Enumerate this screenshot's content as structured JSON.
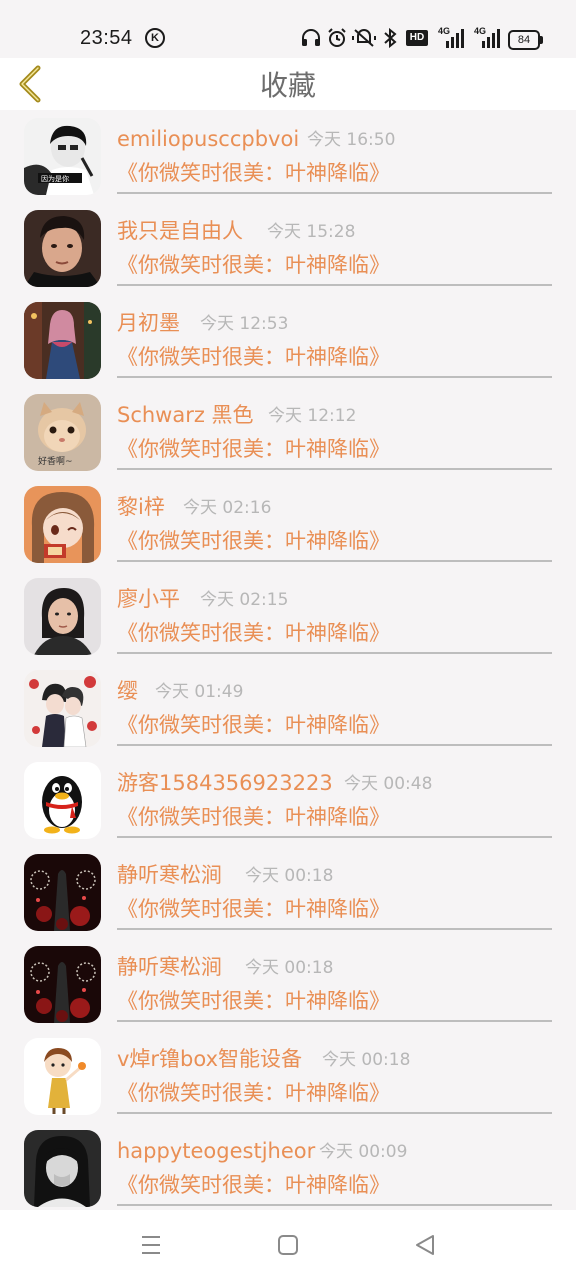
{
  "status_bar": {
    "time": "23:54",
    "k_badge": "K",
    "hd_label": "HD",
    "net1": "4G",
    "net2": "4G",
    "battery": "84"
  },
  "header": {
    "title": "收藏",
    "back_icon": "chevron-left-icon",
    "accent": "#a48a1c"
  },
  "items": [
    {
      "name": "emiliopusccpbvoi",
      "time": "今天 16:50",
      "book": "《你微笑时很美：叶神降临》",
      "avatar": "avatar-bw-man"
    },
    {
      "name": "我只是自由人",
      "time": "今天 15:28",
      "book": "《你微笑时很美：叶神降临》",
      "avatar": "avatar-man-dark"
    },
    {
      "name": "月初墨",
      "time": "今天 12:53",
      "book": "《你微笑时很美：叶神降临》",
      "avatar": "avatar-girl-dress"
    },
    {
      "name": "Schwarz 黑色",
      "time": "今天 12:12",
      "book": "《你微笑时很美：叶神降临》",
      "avatar": "avatar-kitten"
    },
    {
      "name": "黎i梓",
      "time": "今天 02:16",
      "book": "《你微笑时很美：叶神降临》",
      "avatar": "avatar-anime-girl"
    },
    {
      "name": "廖小平",
      "time": "今天 02:15",
      "book": "《你微笑时很美：叶神降临》",
      "avatar": "avatar-woman"
    },
    {
      "name": "缨",
      "time": "今天 01:49",
      "book": "《你微笑时很美：叶神降临》",
      "avatar": "avatar-anime-couple"
    },
    {
      "name": "游客1584356923223",
      "time": "今天 00:48",
      "book": "《你微笑时很美：叶神降临》",
      "avatar": "avatar-qq-penguin"
    },
    {
      "name": "静听寒松涧",
      "time": "今天 00:18",
      "book": "《你微笑时很美：叶神降临》",
      "avatar": "avatar-dark-red"
    },
    {
      "name": "静听寒松涧",
      "time": "今天 00:18",
      "book": "《你微笑时很美：叶神降临》",
      "avatar": "avatar-dark-red"
    },
    {
      "name": "v焯r镥box智能设备",
      "time": "今天 00:18",
      "book": "《你微笑时很美：叶神降临》",
      "avatar": "avatar-cartoon-girl"
    },
    {
      "name": "happyteogestjheor",
      "time": "今天 00:09",
      "book": "《你微笑时很美：叶神降临》",
      "avatar": "avatar-bw-girl"
    }
  ],
  "colors": {
    "name": "#e98f55",
    "time": "#b7b7b7",
    "divider": "#bdbdbd",
    "background": "#f6f4f5"
  },
  "navbar": {
    "menu": "menu-icon",
    "home": "square-home-icon",
    "back": "triangle-back-icon"
  }
}
